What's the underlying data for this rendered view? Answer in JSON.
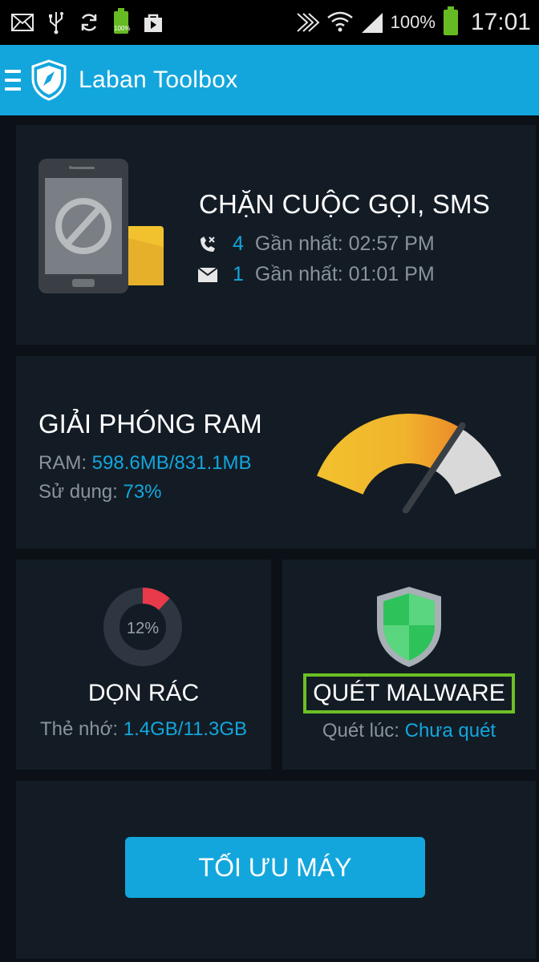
{
  "status_bar": {
    "icons": [
      "mail-icon",
      "usb-icon",
      "sync-icon",
      "battery-charged-icon",
      "shopping-bag-icon",
      "nfc-icon",
      "wifi-icon",
      "signal-icon",
      "battery-icon"
    ],
    "battery_small_label": "100%",
    "battery_percent": "100%",
    "time": "17:01"
  },
  "app_bar": {
    "title": "Laban Toolbox",
    "icons": [
      "menu-icon",
      "laban-shield-logo"
    ]
  },
  "call_sms": {
    "title": "CHẶN CUỘC GỌI, SMS",
    "calls_count": "4",
    "calls_last": "Gần nhất: 02:57 PM",
    "sms_count": "1",
    "sms_last": "Gần nhất: 01:01 PM",
    "icons": [
      "blocked-phone-icon",
      "call-blocked-icon",
      "envelope-icon"
    ]
  },
  "ram": {
    "title": "GIẢI PHÓNG RAM",
    "ram_label": "RAM: ",
    "ram_value": "598.6MB/831.1MB",
    "usage_label": "Sử dụng: ",
    "usage_value": "73%",
    "usage_fraction": 0.73
  },
  "junk": {
    "title": "DỌN RÁC",
    "percent_label": "12%",
    "percent_value": 0.12,
    "storage_label": "Thẻ nhớ: ",
    "storage_value": "1.4GB/11.3GB"
  },
  "malware": {
    "title": "QUÉT MALWARE",
    "scan_label": "Quét lúc: ",
    "scan_value": "Chưa quét"
  },
  "optimize": {
    "button_label": "TỐI ƯU MÁY"
  },
  "colors": {
    "accent": "#13a6dd",
    "card_bg": "#131c25",
    "page_bg": "#0b1116",
    "highlight_border": "#6cc024",
    "gauge_yellow": "#f2c12e",
    "gauge_orange": "#ec8a2a",
    "donut_red": "#e83a4a"
  }
}
